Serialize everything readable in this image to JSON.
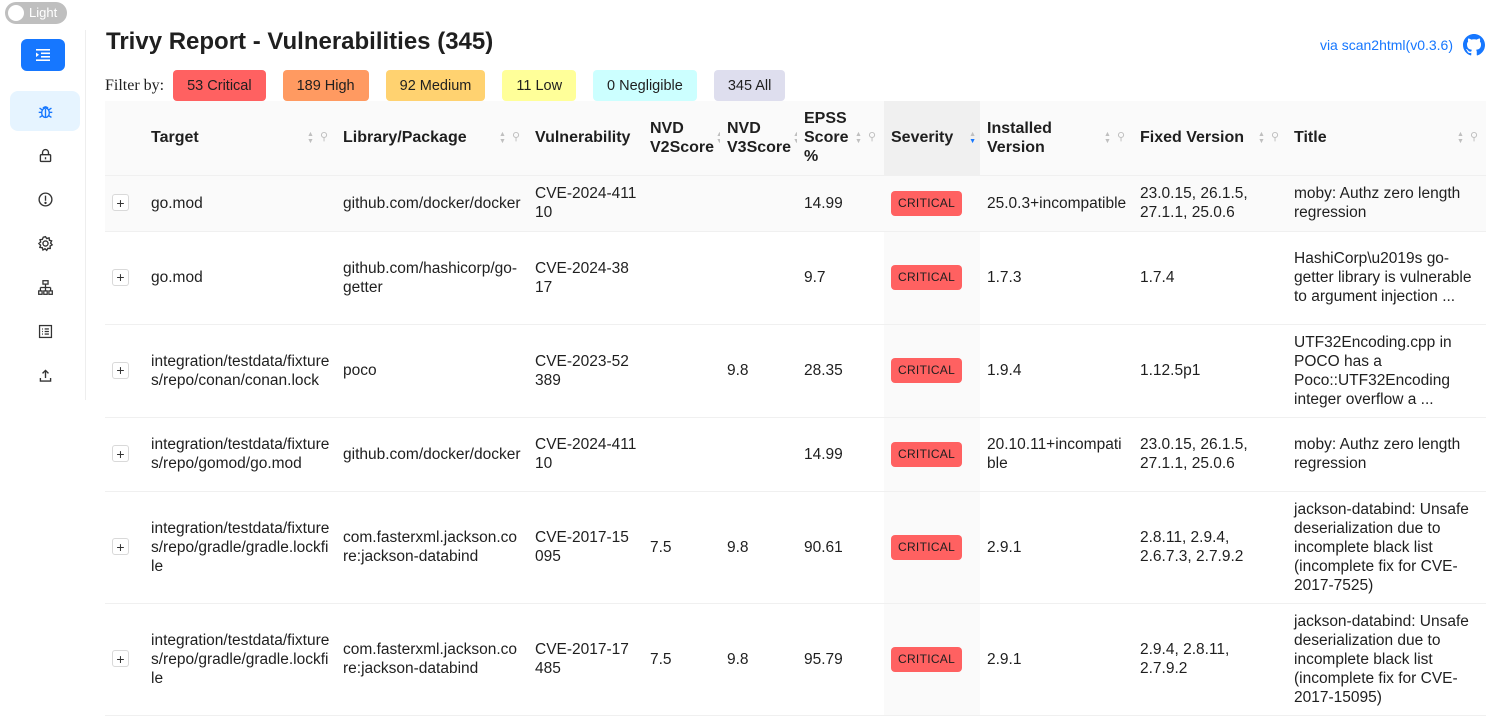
{
  "theme_toggle": {
    "label": "Light"
  },
  "header": {
    "title": "Trivy Report - Vulnerabilities (345)",
    "via_link": "via scan2html(v0.3.6)"
  },
  "sidebar": {
    "items": [
      {
        "icon": "bug-icon",
        "active": true
      },
      {
        "icon": "lock-icon",
        "active": false
      },
      {
        "icon": "exclamation-circle-icon",
        "active": false
      },
      {
        "icon": "gear-icon",
        "active": false
      },
      {
        "icon": "cluster-icon",
        "active": false
      },
      {
        "icon": "list-icon",
        "active": false
      },
      {
        "icon": "upload-icon",
        "active": false
      }
    ]
  },
  "filter": {
    "label": "Filter by:",
    "buttons": [
      {
        "label": "53 Critical",
        "color": "#ff6161"
      },
      {
        "label": "189 High",
        "color": "#ff9a61"
      },
      {
        "label": "92 Medium",
        "color": "#ffd270"
      },
      {
        "label": "11 Low",
        "color": "#ffff99"
      },
      {
        "label": "0 Negligible",
        "color": "#ccffff"
      },
      {
        "label": "345 All",
        "color": "#dedeee"
      }
    ]
  },
  "table": {
    "columns": [
      {
        "label": "Target"
      },
      {
        "label": "Library/Package"
      },
      {
        "label": "Vulnerability"
      },
      {
        "label": "NVD V2Score"
      },
      {
        "label": "NVD V3Score"
      },
      {
        "label": "EPSS Score %"
      },
      {
        "label": "Severity"
      },
      {
        "label": "Installed Version"
      },
      {
        "label": "Fixed Version"
      },
      {
        "label": "Title"
      }
    ],
    "rows": [
      {
        "target": "go.mod",
        "package": "github.com/docker/docker",
        "vuln": "CVE-2024-41110",
        "v2": "",
        "v3": "",
        "epss": "14.99",
        "severity": "CRITICAL",
        "installed": "25.0.3+incompatible",
        "fixed": "23.0.15, 26.1.5, 27.1.1, 25.0.6",
        "title": "moby: Authz zero length regression"
      },
      {
        "target": "go.mod",
        "package": "github.com/hashicorp/go-getter",
        "vuln": "CVE-2024-3817",
        "v2": "",
        "v3": "",
        "epss": "9.7",
        "severity": "CRITICAL",
        "installed": "1.7.3",
        "fixed": "1.7.4",
        "title": "HashiCorp\\u2019s go-getter library is vulnerable to argument injection ..."
      },
      {
        "target": "integration/testdata/fixtures/repo/conan/conan.lock",
        "package": "poco",
        "vuln": "CVE-2023-52389",
        "v2": "",
        "v3": "9.8",
        "epss": "28.35",
        "severity": "CRITICAL",
        "installed": "1.9.4",
        "fixed": "1.12.5p1",
        "title": "UTF32Encoding.cpp in POCO has a Poco::UTF32Encoding integer overflow a ..."
      },
      {
        "target": "integration/testdata/fixtures/repo/gomod/go.mod",
        "package": "github.com/docker/docker",
        "vuln": "CVE-2024-41110",
        "v2": "",
        "v3": "",
        "epss": "14.99",
        "severity": "CRITICAL",
        "installed": "20.10.11+incompatible",
        "fixed": "23.0.15, 26.1.5, 27.1.1, 25.0.6",
        "title": "moby: Authz zero length regression"
      },
      {
        "target": "integration/testdata/fixtures/repo/gradle/gradle.lockfile",
        "package": "com.fasterxml.jackson.core:jackson-databind",
        "vuln": "CVE-2017-15095",
        "v2": "7.5",
        "v3": "9.8",
        "epss": "90.61",
        "severity": "CRITICAL",
        "installed": "2.9.1",
        "fixed": "2.8.11, 2.9.4, 2.6.7.3, 2.7.9.2",
        "title": "jackson-databind: Unsafe deserialization due to incomplete black list (incomplete fix for CVE-2017-7525)"
      },
      {
        "target": "integration/testdata/fixtures/repo/gradle/gradle.lockfile",
        "package": "com.fasterxml.jackson.core:jackson-databind",
        "vuln": "CVE-2017-17485",
        "v2": "7.5",
        "v3": "9.8",
        "epss": "95.79",
        "severity": "CRITICAL",
        "installed": "2.9.1",
        "fixed": "2.9.4, 2.8.11, 2.7.9.2",
        "title": "jackson-databind: Unsafe deserialization due to incomplete black list (incomplete fix for CVE-2017-15095)"
      }
    ]
  }
}
